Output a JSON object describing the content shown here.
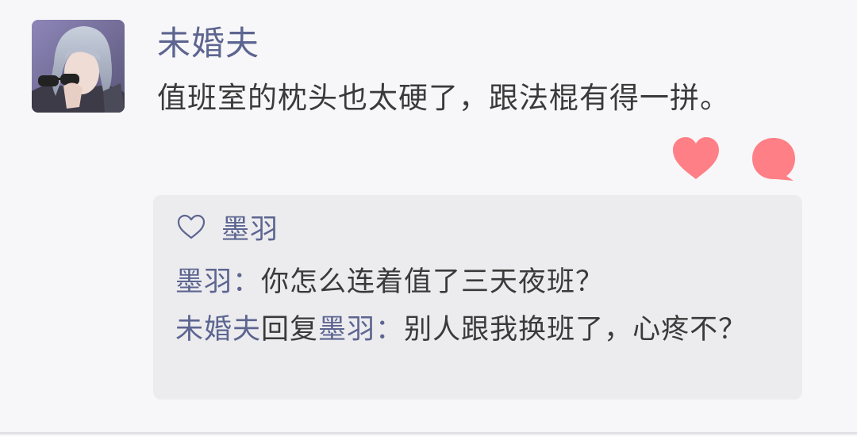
{
  "post": {
    "author": "未婚夫",
    "text": "值班室的枕头也太硬了，跟法棍有得一拼。"
  },
  "actions": {
    "like_icon": "heart-filled-icon",
    "comment_icon": "speech-bubble-icon",
    "accent_color": "#ff7f86"
  },
  "comments": {
    "liker": "墨羽",
    "items": [
      {
        "name": "墨羽",
        "separator": "：",
        "text": "你怎么连着值了三天夜班？"
      },
      {
        "name": "未婚夫",
        "reply_word": "回复",
        "reply_to": "墨羽",
        "separator": "：",
        "text": "别人跟我换班了，心疼不？"
      }
    ]
  }
}
